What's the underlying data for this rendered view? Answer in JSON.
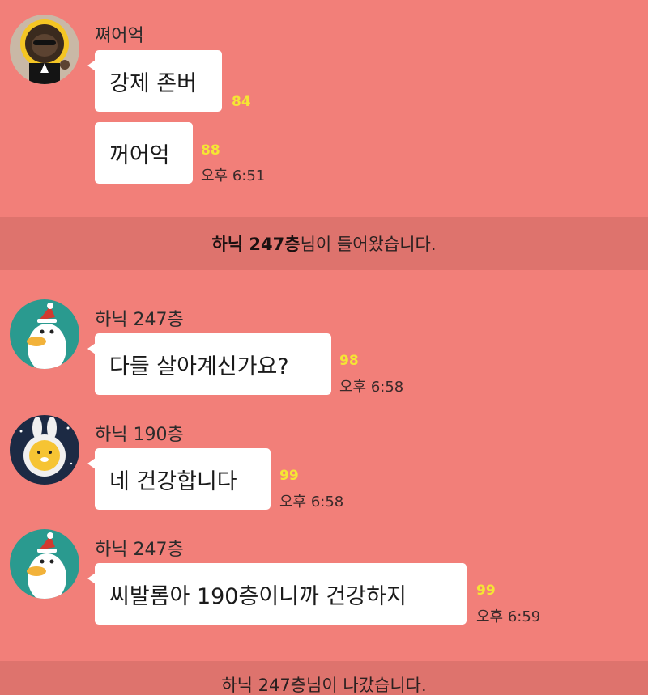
{
  "colors": {
    "background": "#f27f79",
    "bubble": "#ffffff",
    "unread_count": "#f5e534",
    "notice_bar": "#d86a65"
  },
  "messages": [
    {
      "sender": "쪄어억",
      "avatar_icon": "black-afro-character-avatar-icon",
      "bubbles": [
        {
          "text": "강제 존버",
          "unread": "84",
          "time": ""
        },
        {
          "text": "꺼어억",
          "unread": "88",
          "time": "오후 6:51"
        }
      ]
    },
    {
      "notice": {
        "name": "하닉 247층",
        "suffix": "님이 들어왔습니다."
      }
    },
    {
      "sender": "하닉 247층",
      "avatar_icon": "duck-santa-hat-avatar-icon",
      "bubbles": [
        {
          "text": "다들 살아계신가요?",
          "unread": "98",
          "time": "오후 6:58"
        }
      ]
    },
    {
      "sender": "하닉 190층",
      "avatar_icon": "lion-rabbit-costume-avatar-icon",
      "bubbles": [
        {
          "text": "네 건강합니다",
          "unread": "99",
          "time": "오후 6:58"
        }
      ]
    },
    {
      "sender": "하닉 247층",
      "avatar_icon": "duck-santa-hat-avatar-icon",
      "bubbles": [
        {
          "text": "씨발롬아 190층이니까 건강하지",
          "unread": "99",
          "time": "오후 6:59"
        }
      ]
    },
    {
      "notice": {
        "text": "하닉 247층님이 나갔습니다."
      }
    }
  ]
}
